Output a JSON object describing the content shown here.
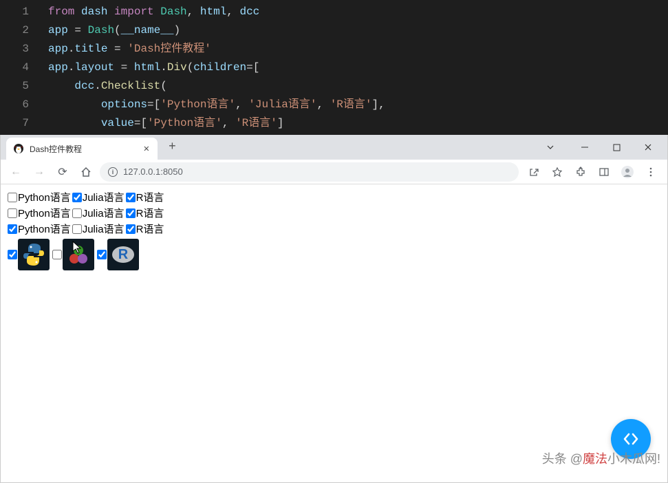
{
  "editor": {
    "lines": [
      {
        "n": "1",
        "tokens": [
          [
            "kw",
            "from"
          ],
          [
            "pun",
            " "
          ],
          [
            "var",
            "dash"
          ],
          [
            "pun",
            " "
          ],
          [
            "kw",
            "import"
          ],
          [
            "pun",
            " "
          ],
          [
            "cls",
            "Dash"
          ],
          [
            "op",
            ", "
          ],
          [
            "var",
            "html"
          ],
          [
            "op",
            ", "
          ],
          [
            "var",
            "dcc"
          ]
        ]
      },
      {
        "n": "2",
        "tokens": [
          [
            "var",
            "app"
          ],
          [
            "pun",
            " "
          ],
          [
            "op",
            "="
          ],
          [
            "pun",
            " "
          ],
          [
            "cls",
            "Dash"
          ],
          [
            "pun",
            "("
          ],
          [
            "var",
            "__name__"
          ],
          [
            "pun",
            ")"
          ]
        ]
      },
      {
        "n": "3",
        "tokens": [
          [
            "var",
            "app"
          ],
          [
            "pun",
            "."
          ],
          [
            "var",
            "title"
          ],
          [
            "pun",
            " "
          ],
          [
            "op",
            "="
          ],
          [
            "pun",
            " "
          ],
          [
            "str",
            "'Dash控件教程'"
          ]
        ]
      },
      {
        "n": "4",
        "tokens": [
          [
            "var",
            "app"
          ],
          [
            "pun",
            "."
          ],
          [
            "var",
            "layout"
          ],
          [
            "pun",
            " "
          ],
          [
            "op",
            "="
          ],
          [
            "pun",
            " "
          ],
          [
            "var",
            "html"
          ],
          [
            "pun",
            "."
          ],
          [
            "fn",
            "Div"
          ],
          [
            "pun",
            "("
          ],
          [
            "var",
            "children"
          ],
          [
            "op",
            "="
          ],
          [
            "pun",
            "["
          ]
        ]
      },
      {
        "n": "5",
        "tokens": [
          [
            "pun",
            "    "
          ],
          [
            "var",
            "dcc"
          ],
          [
            "pun",
            "."
          ],
          [
            "fn",
            "Checklist"
          ],
          [
            "pun",
            "("
          ]
        ]
      },
      {
        "n": "6",
        "tokens": [
          [
            "pun",
            "        "
          ],
          [
            "var",
            "options"
          ],
          [
            "op",
            "="
          ],
          [
            "pun",
            "["
          ],
          [
            "str",
            "'Python语言'"
          ],
          [
            "pun",
            ", "
          ],
          [
            "str",
            "'Julia语言'"
          ],
          [
            "pun",
            ", "
          ],
          [
            "str",
            "'R语言'"
          ],
          [
            "pun",
            "],"
          ]
        ]
      },
      {
        "n": "7",
        "tokens": [
          [
            "pun",
            "        "
          ],
          [
            "var",
            "value"
          ],
          [
            "op",
            "="
          ],
          [
            "pun",
            "["
          ],
          [
            "str",
            "'Python语言'"
          ],
          [
            "pun",
            ", "
          ],
          [
            "str",
            "'R语言'"
          ],
          [
            "pun",
            "]"
          ]
        ]
      }
    ]
  },
  "browser": {
    "tab_title": "Dash控件教程",
    "url": "127.0.0.1:8050"
  },
  "page": {
    "rows": [
      [
        {
          "label": "Python语言",
          "checked": false
        },
        {
          "label": "Julia语言",
          "checked": true
        },
        {
          "label": "R语言",
          "checked": true
        }
      ],
      [
        {
          "label": "Python语言",
          "checked": false
        },
        {
          "label": "Julia语言",
          "checked": false
        },
        {
          "label": "R语言",
          "checked": true
        }
      ],
      [
        {
          "label": "Python语言",
          "checked": true
        },
        {
          "label": "Julia语言",
          "checked": false
        },
        {
          "label": "R语言",
          "checked": true
        }
      ]
    ],
    "iconrow": [
      {
        "checked": true
      },
      {
        "checked": false
      },
      {
        "checked": true
      }
    ]
  },
  "watermark": {
    "prefix": "头条 @",
    "hl": "魔法",
    "rest": "小木瓜网!"
  }
}
